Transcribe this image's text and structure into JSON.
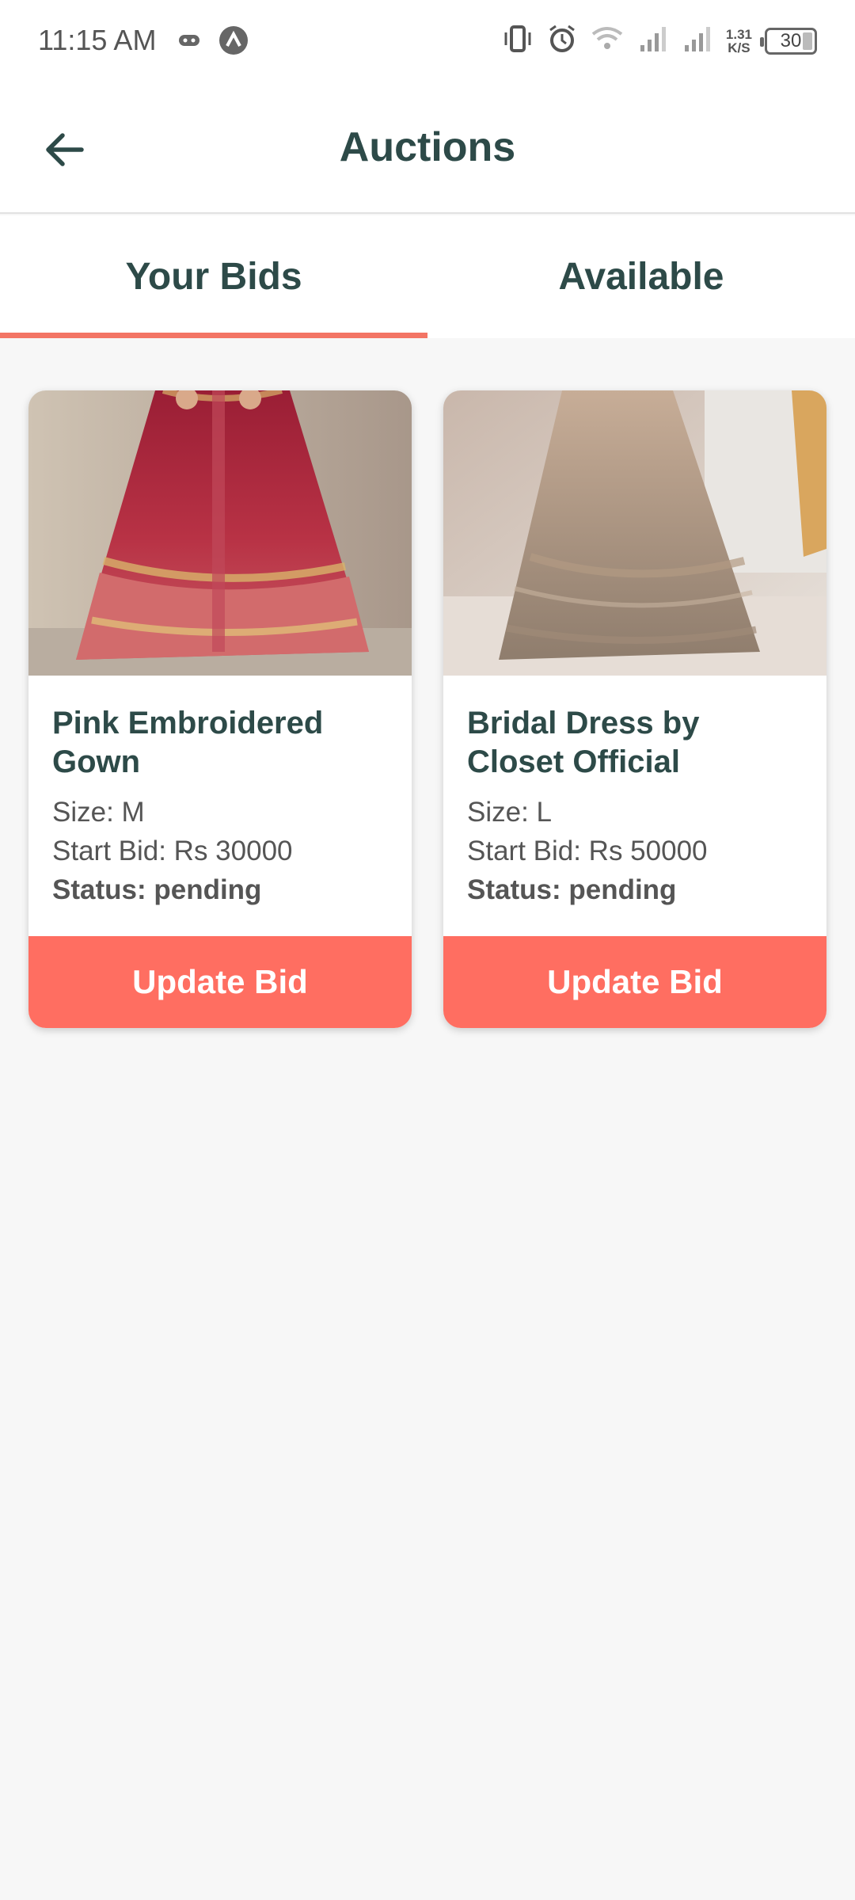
{
  "status_bar": {
    "time": "11:15 AM",
    "speed_value": "1.31",
    "speed_unit": "K/S",
    "battery": "30"
  },
  "app_bar": {
    "title": "Auctions"
  },
  "tabs": [
    {
      "label": "Your Bids",
      "active": true
    },
    {
      "label": "Available",
      "active": false
    }
  ],
  "listings": [
    {
      "title": "Pink Embroidered Gown",
      "size": "Size: M",
      "start_bid": "Start Bid: Rs 30000",
      "status": "Status: pending",
      "button_label": "Update Bid"
    },
    {
      "title": "Bridal Dress by Closet Official",
      "size": "Size: L",
      "start_bid": "Start Bid: Rs 50000",
      "status": "Status: pending",
      "button_label": "Update Bid"
    }
  ],
  "colors": {
    "accent": "#ff6e61",
    "title_text": "#2d4a48",
    "tab_indicator": "#f37565"
  },
  "icons": {
    "back": "arrow-left-icon",
    "vibrate": "vibrate-icon",
    "alarm": "alarm-icon",
    "wifi": "wifi-icon",
    "signal": "signal-icon"
  }
}
